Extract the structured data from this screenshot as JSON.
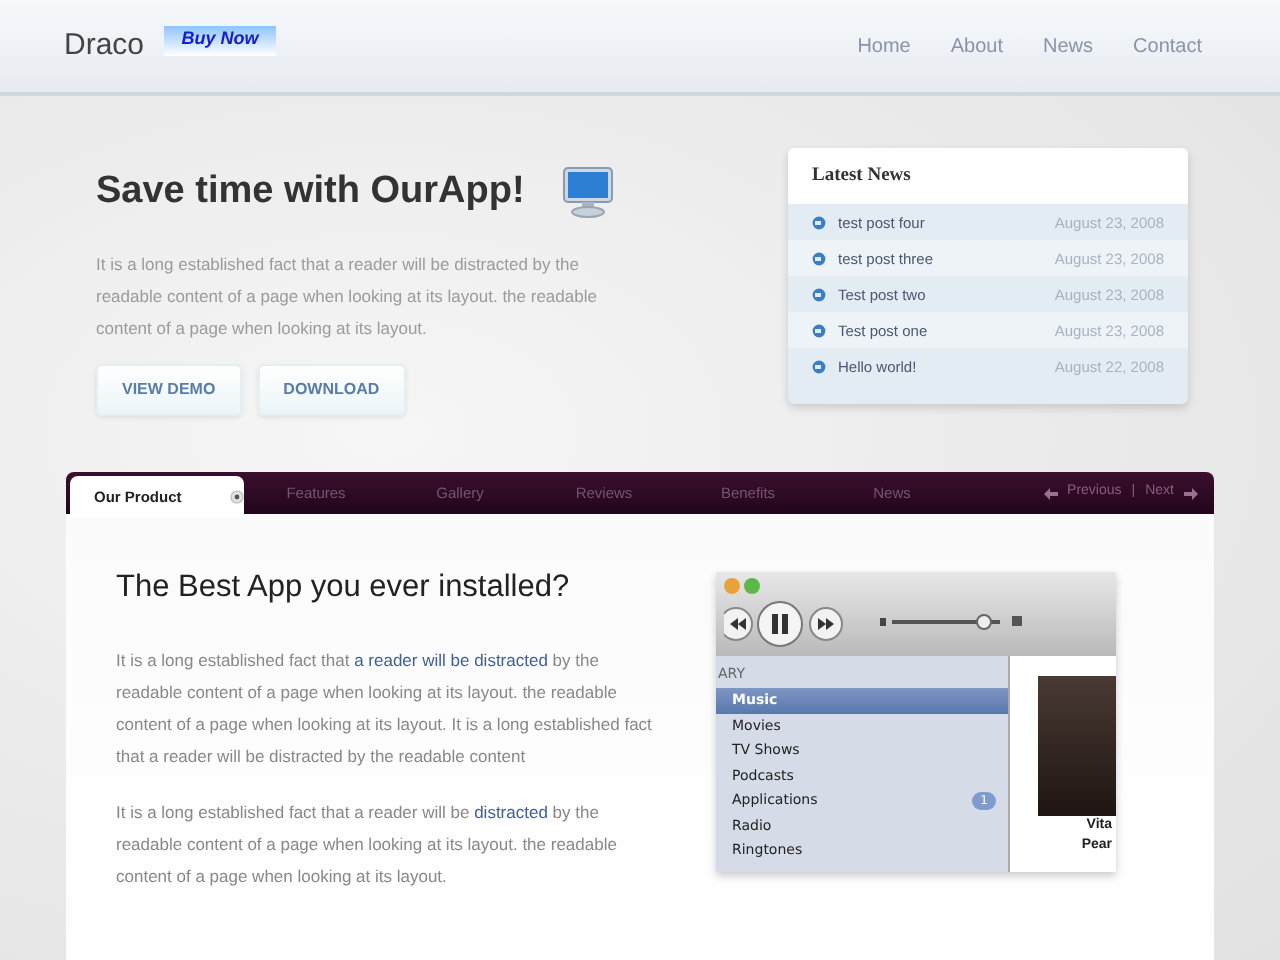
{
  "header": {
    "logo": "Draco",
    "badge": "Buy Now",
    "nav": [
      {
        "label": "Home"
      },
      {
        "label": "About"
      },
      {
        "label": "News"
      },
      {
        "label": "Contact"
      }
    ]
  },
  "hero": {
    "title": "Save time with OurApp!",
    "text": "It is a long established fact that a reader will be distracted by the readable content of a page when looking at its layout. the readable content of a page when looking at its layout.",
    "buttons": [
      "VIEW DEMO",
      "DOWNLOAD"
    ]
  },
  "latest_news": {
    "title": "Latest News",
    "items": [
      {
        "title": "test post four",
        "date": "August 23, 2008"
      },
      {
        "title": "test post three",
        "date": "August 23, 2008"
      },
      {
        "title": "Test post two",
        "date": "August 23, 2008"
      },
      {
        "title": "Test post one",
        "date": "August 23, 2008"
      },
      {
        "title": "Hello world!",
        "date": "August 22, 2008"
      }
    ]
  },
  "tabs": [
    {
      "label": "Our Product",
      "selected": true
    },
    {
      "label": "Features",
      "selected": false
    },
    {
      "label": "Gallery",
      "selected": false
    },
    {
      "label": "Reviews",
      "selected": false
    },
    {
      "label": "Benefits",
      "selected": false
    },
    {
      "label": "News",
      "selected": false
    }
  ],
  "pager": {
    "previous": "Previous",
    "separator": "|",
    "next": "Next"
  },
  "content": {
    "title": "The Best App you ever installed?",
    "paragraphs": [
      [
        {
          "kind": "plain",
          "text": "It is a long established fact that "
        },
        {
          "kind": "link",
          "text": "a reader will be distracted"
        },
        {
          "kind": "plain",
          "text": " by the readable content of a page when looking at its layout. the readable content of a page when looking at its layout. It is a long established fact that a reader will be distracted by the readable content"
        }
      ],
      [
        {
          "kind": "plain",
          "text": "It is a long established fact that a reader will be "
        },
        {
          "kind": "link",
          "text": "distracted"
        },
        {
          "kind": "plain",
          "text": " by the readable content of a page when looking at its layout. the readable content of a page when looking at its layout."
        }
      ]
    ]
  },
  "screenshot": {
    "volume": {
      "level": 0.85
    },
    "section": "ARY",
    "items": [
      {
        "label": "Music",
        "selected": true
      },
      {
        "label": "Movies",
        "selected": false
      },
      {
        "label": "TV Shows",
        "selected": false
      },
      {
        "label": "Podcasts",
        "selected": false
      },
      {
        "label": "Applications",
        "selected": false,
        "count": "1"
      },
      {
        "label": "Radio",
        "selected": false
      },
      {
        "label": "Ringtones",
        "selected": false
      }
    ],
    "album_caption": [
      "Vita",
      "Pear"
    ]
  }
}
